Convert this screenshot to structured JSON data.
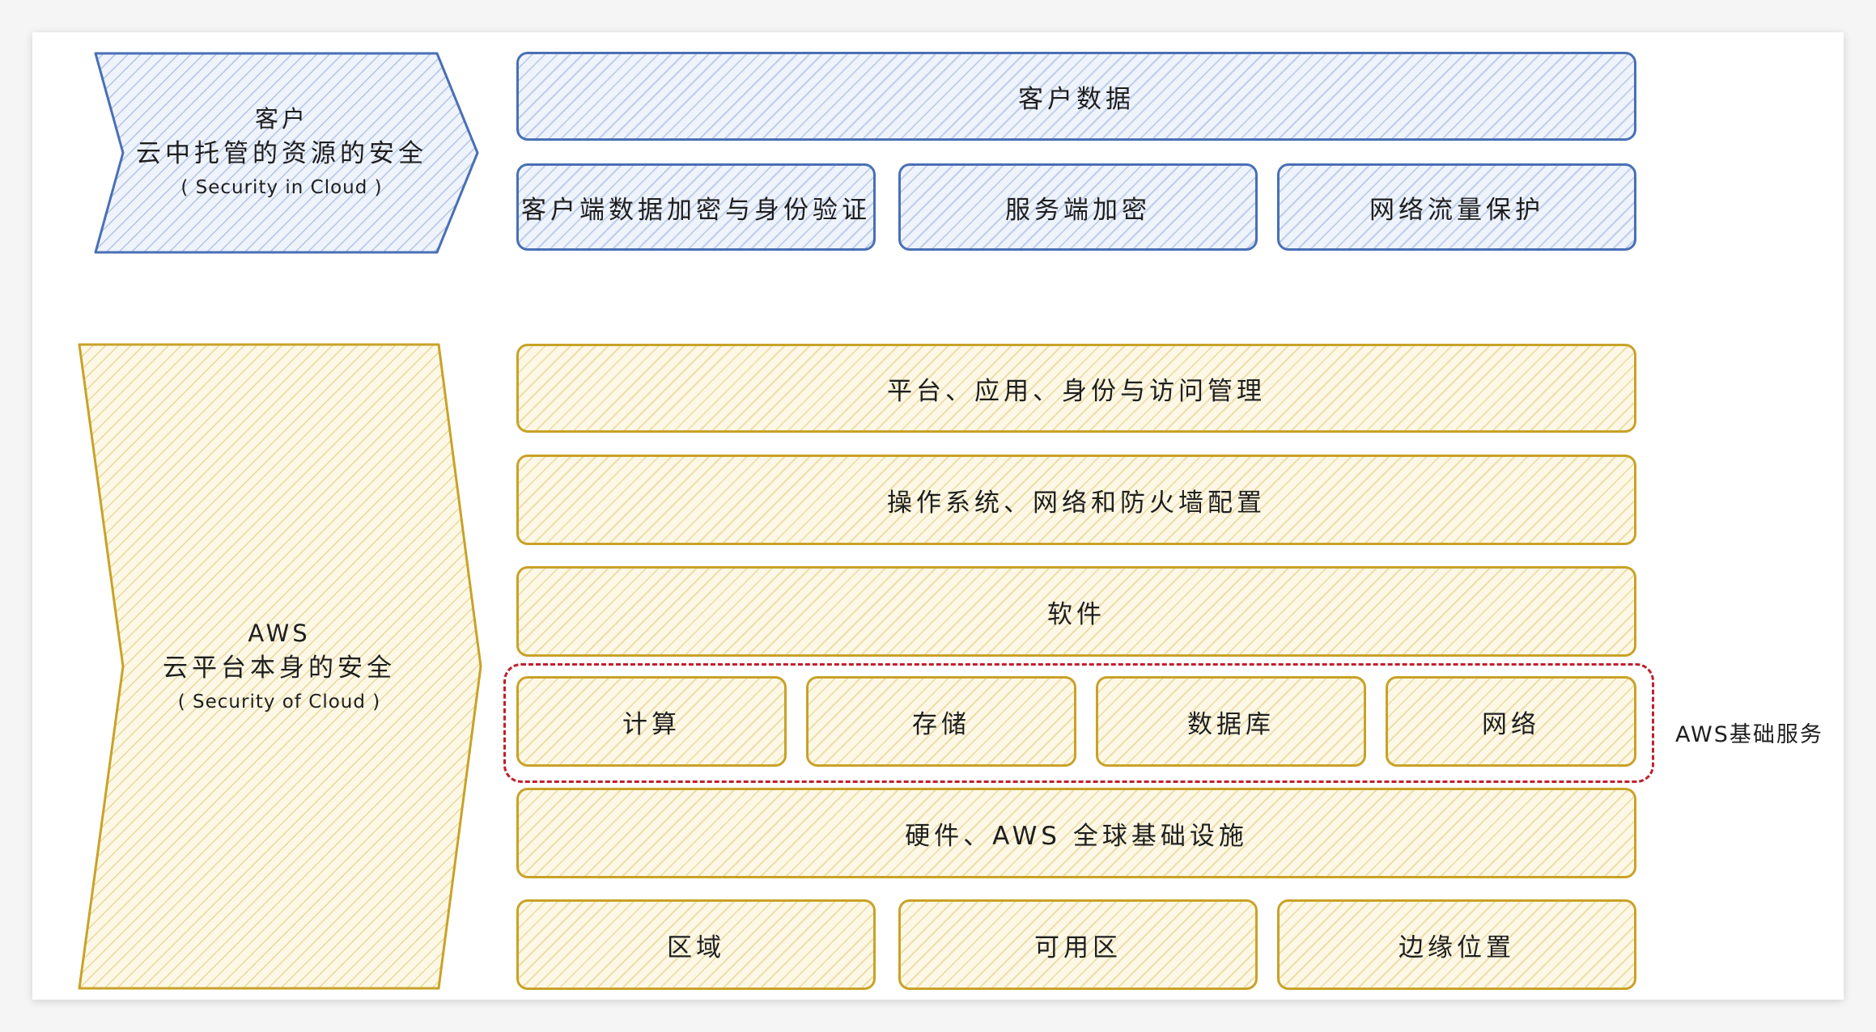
{
  "customer_panel": {
    "line1": "客户",
    "line2": "云中托管的资源的安全",
    "line3": "( Security in Cloud )"
  },
  "customer_layers": {
    "data": "客户数据",
    "sub": [
      "客户端数据加密与身份验证",
      "服务端加密",
      "网络流量保护"
    ]
  },
  "aws_panel": {
    "line1": "AWS",
    "line2": "云平台本身的安全",
    "line3": "( Security of Cloud )"
  },
  "aws_layers": {
    "iam": "平台、应用、身份与访问管理",
    "os": "操作系统、网络和防火墙配置",
    "software": "软件",
    "foundation": [
      "计算",
      "存储",
      "数据库",
      "网络"
    ],
    "foundation_label": "AWS基础服务",
    "hardware": "硬件、AWS 全球基础设施",
    "infra": [
      "区域",
      "可用区",
      "边缘位置"
    ]
  },
  "colors": {
    "customer_stroke": "#4a6fb5",
    "aws_stroke": "#c9a227",
    "highlight_dash": "#c0202e"
  }
}
